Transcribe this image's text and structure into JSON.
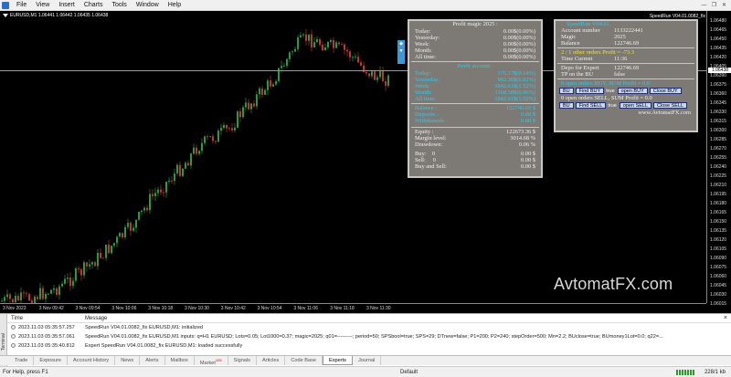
{
  "menu": {
    "items": [
      "File",
      "View",
      "Insert",
      "Charts",
      "Tools",
      "Window",
      "Help"
    ],
    "window_controls": [
      "—",
      "❐",
      "✕"
    ]
  },
  "chart": {
    "header": "EURUSD,M1  1.06441 1.06442 1.06435 1.06438",
    "ea_label": "SpeedRun V04.01.0082_fix",
    "watermark": "AvtomatFX.com",
    "price_labels": [
      "1.06480",
      "1.06465",
      "1.06450",
      "1.06435",
      "1.06420",
      "1.06405",
      "1.06390",
      "1.06375",
      "1.06360",
      "1.06345",
      "1.06330",
      "1.06315",
      "1.06300",
      "1.06285",
      "1.06270",
      "1.06255",
      "1.06240",
      "1.06225",
      "1.06210",
      "1.06195",
      "1.06180",
      "1.06165",
      "1.06150",
      "1.06135",
      "1.06120",
      "1.06105",
      "1.06090",
      "1.06075",
      "1.06060",
      "1.06045",
      "1.06030",
      "1.06015"
    ],
    "current_price": "1.06438",
    "time_labels": [
      "3 Nov 2023",
      "3 Nov 09:42",
      "3 Nov 09:54",
      "3 Nov 10:06",
      "3 Nov 10:18",
      "3 Nov 10:30",
      "3 Nov 10:42",
      "3 Nov 10:54",
      "3 Nov 11:06",
      "3 Nov 11:18",
      "3 Nov 11:30"
    ]
  },
  "profit_panel": {
    "title": "Profit magic 2025 :",
    "rows": [
      {
        "label": "Today:",
        "value": "0.00$(0.00%)"
      },
      {
        "label": "Yesterday:",
        "value": "0.00$(0.00%)"
      },
      {
        "label": "Week:",
        "value": "0.00$(0.00%)"
      },
      {
        "label": "Month:",
        "value": "0.00$(0.00%)"
      },
      {
        "label": "All time:",
        "value": "0.00$(0.00%)"
      }
    ],
    "account_title": "Profit account :",
    "account_rows": [
      {
        "label": "Today:",
        "value": "176.17$(0.14%)"
      },
      {
        "label": "Yesterday:",
        "value": "992.38$(0.82%)"
      },
      {
        "label": "Week:",
        "value": "1842.61$(1.52%)"
      },
      {
        "label": "Month:",
        "value": "1168.38$(0.96%)"
      },
      {
        "label": "All time:",
        "value": "1842.61$(1.52%)"
      }
    ],
    "balance_rows": [
      {
        "label": "Balance :",
        "value": "122746.69 $"
      },
      {
        "label": "Deposits :",
        "value": "0.00 $"
      },
      {
        "label": "Withdrawals :",
        "value": "0.00 $"
      }
    ],
    "equity_rows": [
      {
        "label": "Equity :",
        "value": "122673.36 $"
      },
      {
        "label": "Margin level:",
        "value": "3014.68 %"
      },
      {
        "label": "Drawdown:",
        "value": "0.06 %"
      }
    ],
    "pos_rows": [
      {
        "label": "Buy:",
        "count": "0",
        "value": "0.00 $"
      },
      {
        "label": "Sell:",
        "count": "0",
        "value": "0.00 $"
      },
      {
        "label": "Buy and Sell:",
        "count": "",
        "value": "0.00 $"
      }
    ]
  },
  "speedrun_panel": {
    "title": "SpeedRun V04.01.",
    "info_rows": [
      {
        "label": "Account number",
        "value": "1133222441"
      },
      {
        "label": "Magic",
        "value": "2025"
      },
      {
        "label": "Balance",
        "value": "122746.69"
      }
    ],
    "other_orders": "2 / 1 other orders Profit = -73.3",
    "time_row": {
      "label": "Time Current",
      "value": "11:36"
    },
    "depo_row": {
      "label": "Depo for Expert",
      "value": "122746.69"
    },
    "tp_row": {
      "label": "TP on the BU",
      "value": "false"
    },
    "buy_status": "0 open orders BUY, SUM Profit = 0.0",
    "buy_buttons": {
      "b1": "BU",
      "b2": "Find BUY",
      "val": "true",
      "b3": "open BUY",
      "b4": "Close BUY"
    },
    "sell_status": "0 open orders SELL, SUM Profit = 0.0",
    "sell_buttons": {
      "b1": "BU",
      "b2": "Find SELL",
      "val": "true",
      "b3": "open SELL",
      "b4": "Close SELL"
    },
    "site": "www.AvtomatFX.com"
  },
  "terminal": {
    "side_label": "Terminal",
    "col_time": "Time",
    "col_message": "Message",
    "rows": [
      {
        "time": "2023.11.03 05:35:57.257",
        "message": "SpeedRun V04.01.0082_fix EURUSD,M1: initialized"
      },
      {
        "time": "2023.11.03 05:35:57.061",
        "message": "SpeedRun V04.01.0082_fix EURUSD,M1 inputs: q=H1 EURUSD; Lots=0.05; Lot1000=0.37; magic=2025; q01=---------; period=50; SPSbool=true; SPS=29; DTnew=false; P1=200; P2=240; stepOrder=500; Mn=2.2; BUclose=true; BUmoney1Lot=0.0; q22=..."
      },
      {
        "time": "2023.11.03 05:35:40.812",
        "message": "Expert SpeedRun V04.01.0082_fix EURUSD,M1: loaded successfully"
      }
    ],
    "tabs": [
      "Trade",
      "Exposure",
      "Account History",
      "News",
      "Alerts",
      "Mailbox",
      "Market",
      "Signals",
      "Articles",
      "Code Base",
      "Experts",
      "Journal"
    ],
    "market_badge": "105",
    "active_tab": "Experts"
  },
  "status": {
    "help": "For Help, press F1",
    "profile": "Default",
    "traffic": "228/1 kb"
  }
}
